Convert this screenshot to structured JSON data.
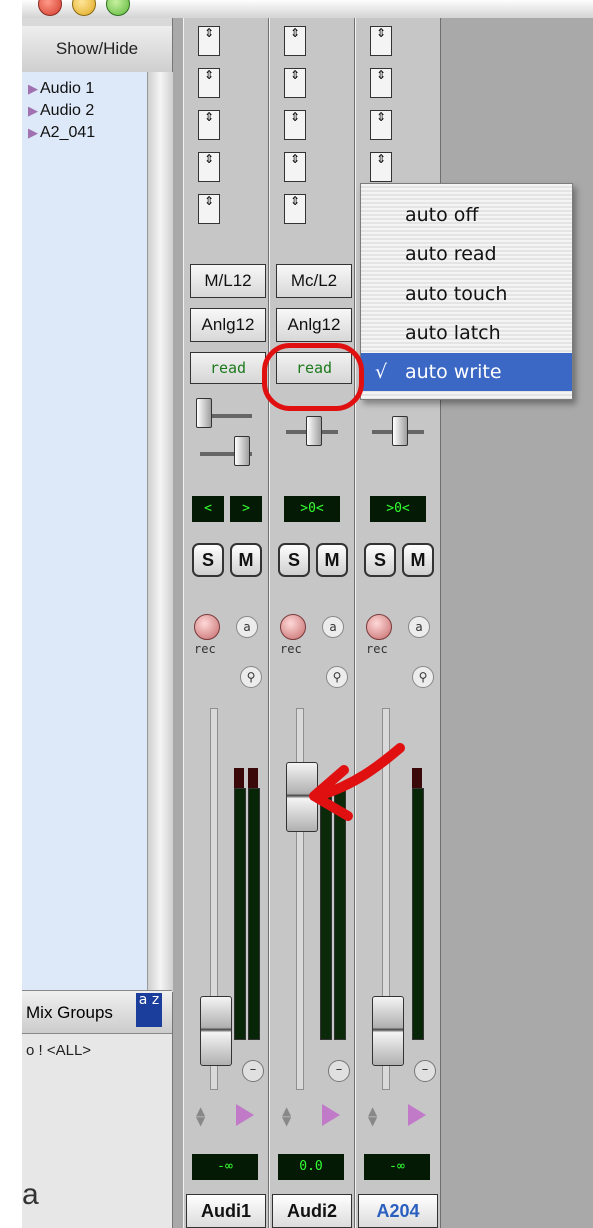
{
  "left_panel": {
    "show_hide_label": "Show/Hide",
    "tracks": [
      "Audio 1",
      "Audio 2",
      "A2_041"
    ],
    "mix_groups_label": "Mix Groups",
    "sort_badge": "a z",
    "group_row": "o ! <ALL>",
    "stray_text": "a"
  },
  "strips": [
    {
      "io_output": "M/L12",
      "io_input": "Anlg12",
      "automation_mode": "read",
      "solo": "S",
      "mute": "M",
      "rec_label": "rec",
      "pan_left": "<",
      "pan_right": ">",
      "volume": "-∞",
      "name": "Audi1"
    },
    {
      "io_output": "Mc/L2",
      "io_input": "Anlg12",
      "automation_mode": "read",
      "solo": "S",
      "mute": "M",
      "rec_label": "rec",
      "pan": ">0<",
      "volume": "0.0",
      "name": "Audi2"
    },
    {
      "automation_mode": "",
      "solo": "S",
      "mute": "M",
      "rec_label": "rec",
      "pan": ">0<",
      "volume": "-∞",
      "name": "A204"
    }
  ],
  "automation_menu": {
    "items": [
      "auto off",
      "auto read",
      "auto touch",
      "auto latch",
      "auto write"
    ],
    "selected": "auto write",
    "check_mark": "√"
  },
  "colors": {
    "menu_selection": "#3a68c4",
    "annotation": "#e01010",
    "lcd_text": "#33ff33",
    "selected_track_name": "#2a5fc0"
  },
  "icons": {
    "insert_selector": "up-down-arrow-icon",
    "record": "record-enable-icon",
    "input_monitor": "input-monitor-icon",
    "output_triangle": "play-triangle-icon"
  }
}
